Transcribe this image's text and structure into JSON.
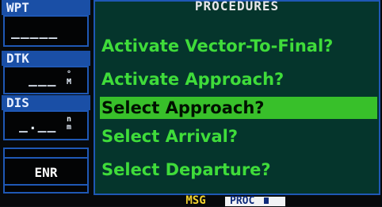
{
  "sidebar": {
    "wpt_label": "WPT",
    "wpt_value": "_____",
    "dtk_label": "DTK",
    "dtk_value": "___",
    "dtk_unit_top": "°",
    "dtk_unit_bottom": "M",
    "dis_label": "DIS",
    "dis_value": "_.__",
    "dis_unit_top": "n",
    "dis_unit_bottom": "m",
    "mode": "ENR"
  },
  "procedures": {
    "title": "PROCEDURES",
    "items": [
      {
        "label": "Activate Vector-To-Final?",
        "selected": false
      },
      {
        "label": "Activate Approach?",
        "selected": false
      },
      {
        "label": "Select Approach?",
        "selected": true
      },
      {
        "label": "Select Arrival?",
        "selected": false
      },
      {
        "label": "Select Departure?",
        "selected": false
      }
    ]
  },
  "status_bar": {
    "msg": "MSG",
    "proc": "PROC"
  },
  "colors": {
    "label_bar": "#1a4fa6",
    "panel_bg": "#05352c",
    "menu_text": "#3fdc3a",
    "selection": "#38c02a",
    "msg": "#f2d22d"
  }
}
